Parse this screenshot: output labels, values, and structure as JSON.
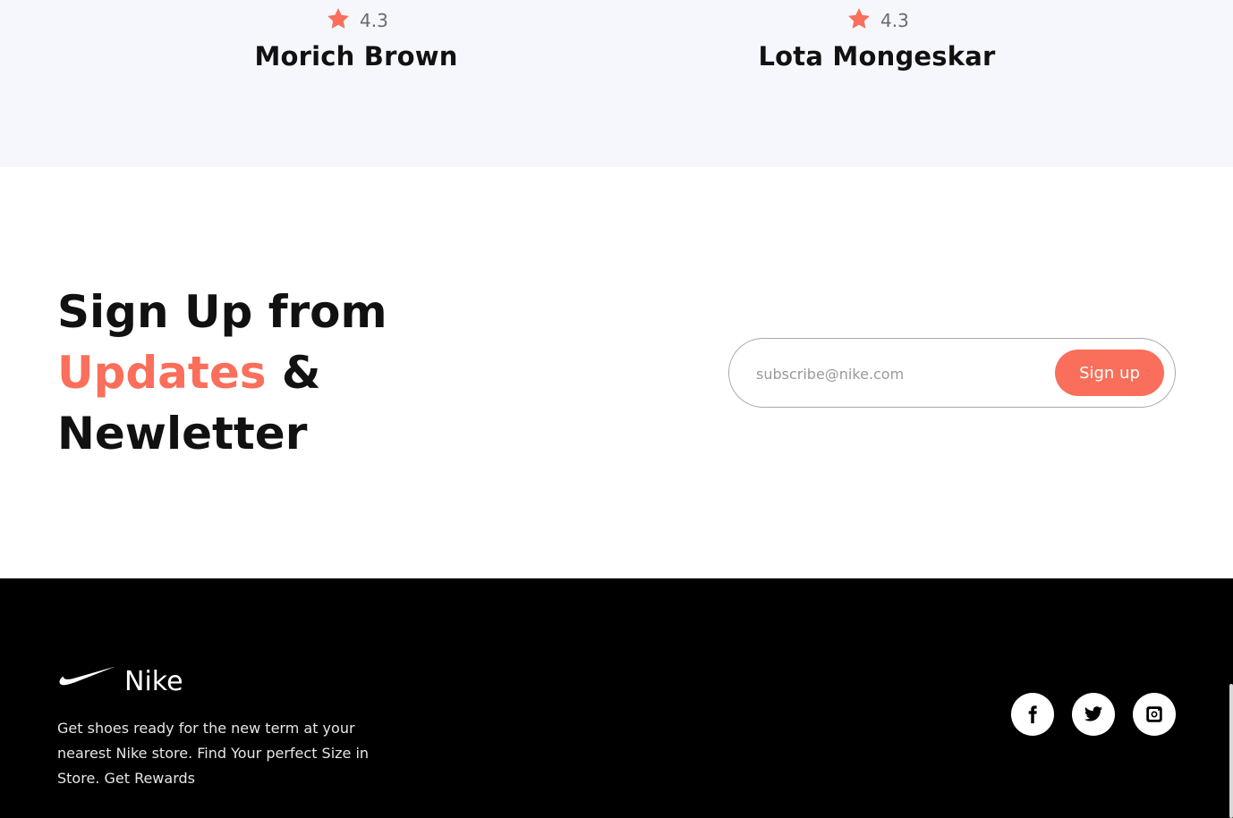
{
  "reviews": [
    {
      "rating": "4.3",
      "name": "Morich Brown",
      "star_icon": "star-icon"
    },
    {
      "rating": "4.3",
      "name": "Lota Mongeskar",
      "star_icon": "star-icon"
    }
  ],
  "signup": {
    "heading_line1": "Sign Up from",
    "heading_accent": "Updates",
    "heading_amp": " &",
    "heading_line3": "Newletter",
    "input_placeholder": "subscribe@nike.com",
    "input_value": "",
    "button_label": "Sign up"
  },
  "footer": {
    "brand_name": "Nike",
    "logo_icon": "nike-swoosh-icon",
    "description": "Get shoes ready for the new term at your nearest Nike store. Find Your perfect Size in Store. Get Rewards",
    "socials": [
      "facebook-icon",
      "twitter-icon",
      "instagram-icon"
    ]
  },
  "colors": {
    "accent": "#f96f5b",
    "review_bg": "#f6f7fd",
    "footer_bg": "#000000",
    "text_dark": "#111111"
  }
}
